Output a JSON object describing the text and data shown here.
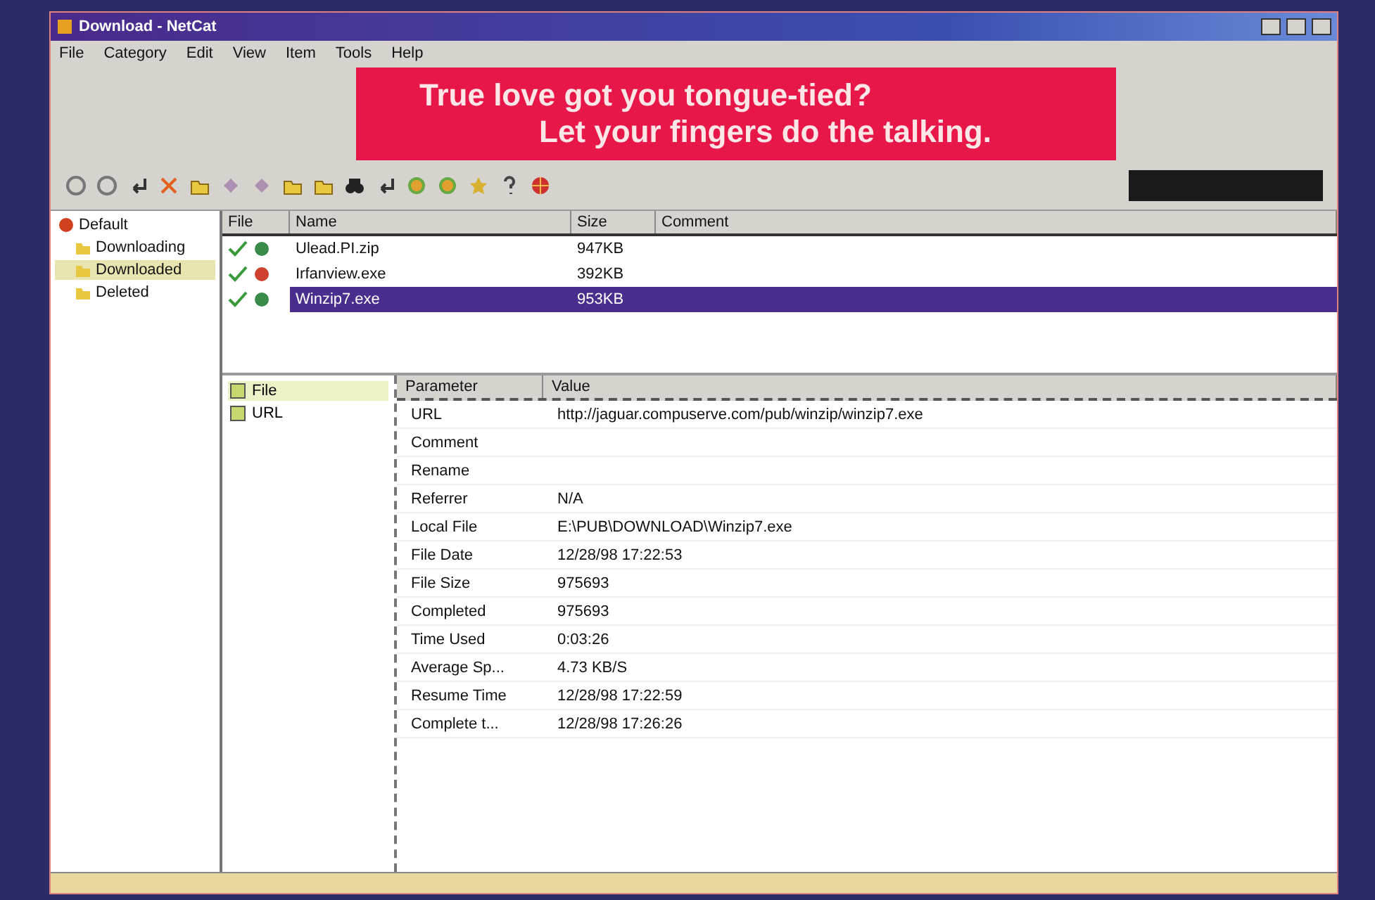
{
  "window": {
    "title": "Download - NetCat"
  },
  "menu": [
    "File",
    "Category",
    "Edit",
    "View",
    "Item",
    "Tools",
    "Help"
  ],
  "banner": {
    "line_1": "True love got you tongue-tied?",
    "line_2": "Let your fingers do the talking."
  },
  "tree": {
    "root": "Default",
    "children": [
      {
        "label": "Downloading",
        "selected": false
      },
      {
        "label": "Downloaded",
        "selected": true
      },
      {
        "label": "Deleted",
        "selected": false
      }
    ]
  },
  "jobs": {
    "columns": [
      "File",
      "Name",
      "Size",
      "Comment"
    ],
    "rows": [
      {
        "name": "Ulead.PI.zip",
        "size": "947KB",
        "done": true,
        "selected": false
      },
      {
        "name": "Irfanview.exe",
        "size": "392KB",
        "done": true,
        "selected": false
      },
      {
        "name": "Winzip7.exe",
        "size": "953KB",
        "done": true,
        "selected": true
      }
    ]
  },
  "detail_tabs": [
    {
      "label": "File",
      "selected": true
    },
    {
      "label": "URL",
      "selected": false
    }
  ],
  "properties": {
    "columns": [
      "Parameter",
      "Value"
    ],
    "rows": [
      {
        "parameter": "URL",
        "value": "http://jaguar.compuserve.com/pub/winzip/winzip7.exe"
      },
      {
        "parameter": "Comment"
      },
      {
        "parameter": "Rename"
      },
      {
        "parameter": "Referrer",
        "value": "N/A"
      },
      {
        "parameter": "Local File",
        "value": "E:\\PUB\\DOWNLOAD\\Winzip7.exe"
      },
      {
        "parameter": "File Date",
        "value": "12/28/98 17:22:53"
      },
      {
        "parameter": "File Size",
        "value": "975693"
      },
      {
        "parameter": "Completed",
        "value": "975693"
      },
      {
        "parameter": "Time Used",
        "value": "0:03:26"
      },
      {
        "parameter": "Average Sp...",
        "value": "4.73 KB/S"
      },
      {
        "parameter": "Resume Time",
        "value": "12/28/98 17:22:59"
      },
      {
        "parameter": "Complete t...",
        "value": "12/28/98 17:26:26"
      }
    ]
  }
}
